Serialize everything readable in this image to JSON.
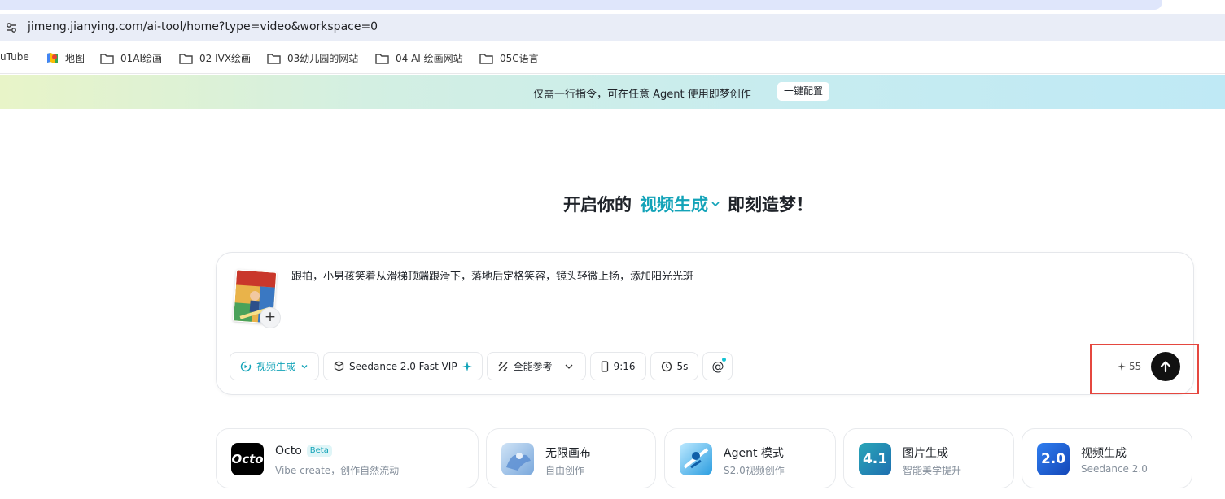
{
  "browser": {
    "url": "jimeng.jianying.com/ai-tool/home?type=video&workspace=0",
    "bookmarks": [
      {
        "label": "uTube",
        "icon": "youtube-icon"
      },
      {
        "label": "地图",
        "icon": "maps-icon"
      },
      {
        "label": "01AI绘画",
        "icon": "folder-icon"
      },
      {
        "label": "02 IVX绘画",
        "icon": "folder-icon"
      },
      {
        "label": "03幼儿园的网站",
        "icon": "folder-icon"
      },
      {
        "label": "04 AI 绘画网站",
        "icon": "folder-icon"
      },
      {
        "label": "05C语言",
        "icon": "folder-icon"
      }
    ]
  },
  "banner": {
    "text": "仅需一行指令，可在任意 Agent 使用即梦创作",
    "button": "一键配置"
  },
  "heading": {
    "prefix": "开启你的",
    "mode": "视频生成",
    "suffix": "即刻造梦！"
  },
  "composer": {
    "prompt": "跟拍，小男孩笑着从滑梯顶端跟滑下，落地后定格笑容，镜头轻微上扬，添加阳光光斑",
    "add_reference": "+",
    "mode_chip": "视频生成",
    "model_chip": "Seedance 2.0 Fast VIP",
    "reference_chip": "全能参考",
    "ratio_chip": "9:16",
    "duration_chip": "5s",
    "mention_chip": "@",
    "credits": "55"
  },
  "features": [
    {
      "title": "Octo",
      "badge": "Beta",
      "subtitle": "Vibe create，创作自然流动",
      "icon": "octo-logo-icon"
    },
    {
      "title": "无限画布",
      "subtitle": "自由创作",
      "icon": "canvas-icon"
    },
    {
      "title": "Agent 模式",
      "subtitle": "S2.0视频创作",
      "icon": "agent-icon"
    },
    {
      "title": "图片生成",
      "subtitle": "智能美学提升",
      "icon": "image-gen-icon",
      "badge_text": "4.1"
    },
    {
      "title": "视频生成",
      "subtitle": "Seedance 2.0",
      "icon": "video-gen-icon",
      "badge_text": "2.0"
    }
  ],
  "colors": {
    "accent": "#13a3b8",
    "highlight_box": "#e5473f",
    "send_button": "#111111"
  }
}
